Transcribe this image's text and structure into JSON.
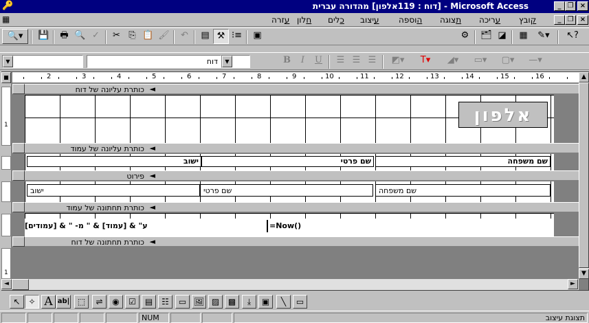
{
  "window": {
    "title": "Microsoft Access - [דוח : 119אלפון]  מהדורה עברית",
    "minimize": "_",
    "restore": "❐",
    "close": "×",
    "doc_minimize": "_",
    "doc_restore": "❐",
    "doc_close": "×"
  },
  "menu": {
    "items": [
      "קובץ",
      "עריכה",
      "תצוגה",
      "הוספה",
      "עיצוב",
      "כלים",
      "חלון",
      "עזרה"
    ]
  },
  "toolbar": {
    "view_icon": "report-view-icon",
    "help_icon": "help-pointer-icon",
    "buttons": [
      "save-icon",
      "print-icon",
      "print-preview-icon",
      "spelling-icon",
      "cut-icon",
      "copy-icon",
      "paste-icon",
      "format-painter-icon",
      "undo-icon",
      "field-list-icon",
      "toolbox-icon",
      "sorting-grouping-icon",
      "properties-icon",
      "build-icon",
      "database-window-icon",
      "new-object-icon"
    ]
  },
  "format_toolbar": {
    "object_combo": "",
    "font_combo": "דוח",
    "size_combo": "",
    "bold": "B",
    "italic": "I",
    "underline": "U"
  },
  "ruler": {
    "numbers": [
      "2",
      "3",
      "4",
      "5",
      "6",
      "7",
      "8",
      "9",
      "10",
      "11",
      "12",
      "13",
      "14",
      "15",
      "16"
    ]
  },
  "sections": {
    "report_header": "כותרת עליונה של דוח",
    "page_header": "כותרת עליונה של עמוד",
    "detail": "פירוט",
    "page_footer": "כותרת תחתונה של עמוד",
    "report_footer": "כותרת תחתונה של דוח"
  },
  "report_header": {
    "logo": "אלפון"
  },
  "page_header_labels": {
    "city": "ישוב",
    "first_name": "שם פרטי",
    "last_name": "שם משפחה"
  },
  "detail_fields": {
    "city": "ישוב",
    "first_name": "שם פרטי",
    "last_name": "שם משפחה"
  },
  "page_footer_fields": {
    "page_expr": "ע\" & [עמוד] & \" מ- \" & [עמודים]",
    "now_expr": "=Now()"
  },
  "vruler_numbers": [
    "1",
    "1"
  ],
  "toolbox": {
    "tools": [
      "select-objects-icon",
      "control-wizards-icon",
      "label-icon",
      "textbox-icon",
      "option-group-icon",
      "toggle-button-icon",
      "option-button-icon",
      "checkbox-icon",
      "combo-box-icon",
      "list-box-icon",
      "command-button-icon",
      "image-icon",
      "unbound-object-frame-icon",
      "bound-object-frame-icon",
      "page-break-icon",
      "subform-icon",
      "line-icon",
      "rectangle-icon"
    ],
    "label_text": "A",
    "textbox_text": "ab|"
  },
  "statusbar": {
    "mode": "תצוגת עיצוב",
    "num": "NUM"
  }
}
